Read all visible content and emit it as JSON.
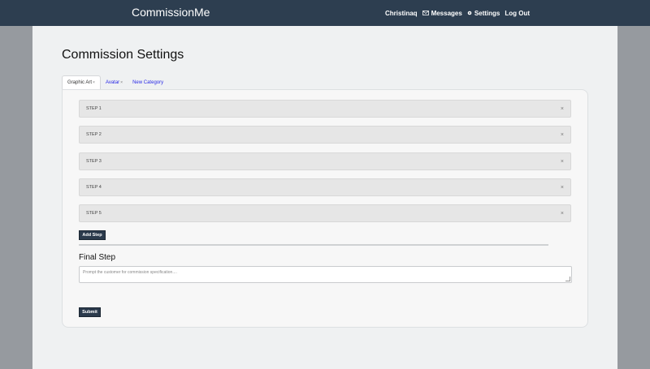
{
  "navbar": {
    "brand": "CommissionMe",
    "user": "Christinaq",
    "messages": "Messages",
    "settings": "Settings",
    "logout": "Log Out",
    "icons": {
      "messages": "envelope-icon",
      "settings": "gear-icon"
    }
  },
  "page": {
    "title": "Commission Settings",
    "tabs": [
      {
        "label": "Graphic Art",
        "close": "×"
      },
      {
        "label": "Avatar",
        "close": "×"
      },
      {
        "label": "New Category"
      }
    ],
    "steps": [
      {
        "label": "STEP 1",
        "close": "×"
      },
      {
        "label": "STEP 2",
        "close": "×"
      },
      {
        "label": "STEP 3",
        "close": "×"
      },
      {
        "label": "STEP 4",
        "close": "×"
      },
      {
        "label": "STEP 5",
        "close": "×"
      }
    ],
    "add_step": "Add Step",
    "final_step_title": "Final Step",
    "final_step_placeholder": "Prompt the customer for commission specification....",
    "submit": "Submit"
  },
  "colors": {
    "navbar": "#2d3e50",
    "background": "#969a9f",
    "page": "#eff1f2",
    "link": "#2a2ae6",
    "button": "#2b3a4c"
  }
}
